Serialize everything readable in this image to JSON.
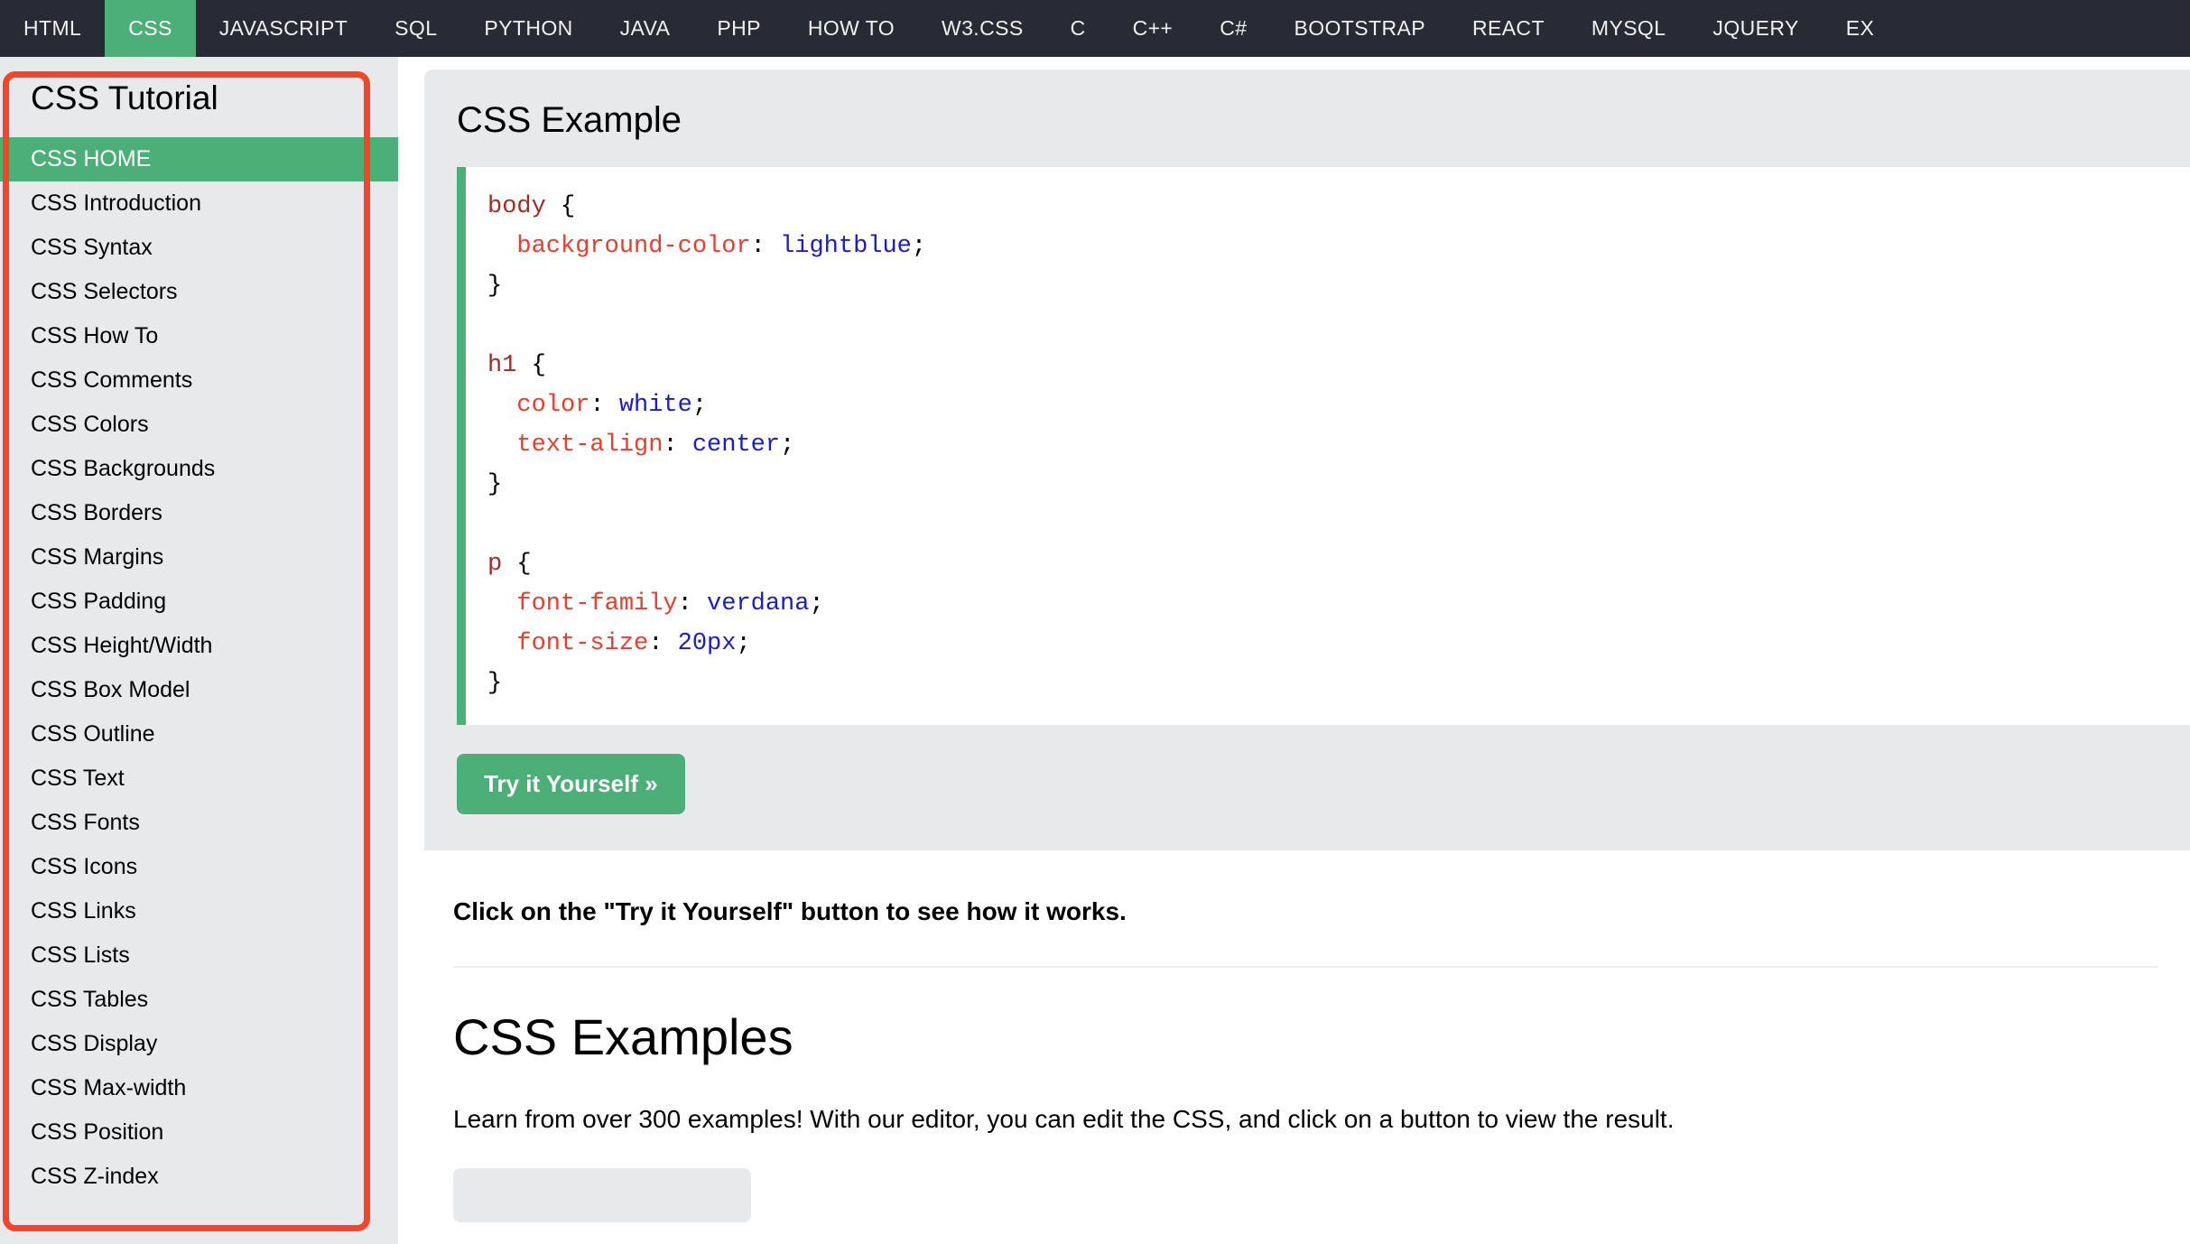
{
  "topnav": {
    "items": [
      {
        "label": "HTML",
        "active": false
      },
      {
        "label": "CSS",
        "active": true
      },
      {
        "label": "JAVASCRIPT",
        "active": false
      },
      {
        "label": "SQL",
        "active": false
      },
      {
        "label": "PYTHON",
        "active": false
      },
      {
        "label": "JAVA",
        "active": false
      },
      {
        "label": "PHP",
        "active": false
      },
      {
        "label": "HOW TO",
        "active": false
      },
      {
        "label": "W3.CSS",
        "active": false
      },
      {
        "label": "C",
        "active": false
      },
      {
        "label": "C++",
        "active": false
      },
      {
        "label": "C#",
        "active": false
      },
      {
        "label": "BOOTSTRAP",
        "active": false
      },
      {
        "label": "REACT",
        "active": false
      },
      {
        "label": "MYSQL",
        "active": false
      },
      {
        "label": "JQUERY",
        "active": false
      },
      {
        "label": "EX",
        "active": false
      }
    ]
  },
  "sidebar": {
    "title": "CSS Tutorial",
    "items": [
      {
        "label": "CSS HOME",
        "active": true
      },
      {
        "label": "CSS Introduction",
        "active": false
      },
      {
        "label": "CSS Syntax",
        "active": false
      },
      {
        "label": "CSS Selectors",
        "active": false
      },
      {
        "label": "CSS How To",
        "active": false
      },
      {
        "label": "CSS Comments",
        "active": false
      },
      {
        "label": "CSS Colors",
        "active": false
      },
      {
        "label": "CSS Backgrounds",
        "active": false
      },
      {
        "label": "CSS Borders",
        "active": false
      },
      {
        "label": "CSS Margins",
        "active": false
      },
      {
        "label": "CSS Padding",
        "active": false
      },
      {
        "label": "CSS Height/Width",
        "active": false
      },
      {
        "label": "CSS Box Model",
        "active": false
      },
      {
        "label": "CSS Outline",
        "active": false
      },
      {
        "label": "CSS Text",
        "active": false
      },
      {
        "label": "CSS Fonts",
        "active": false
      },
      {
        "label": "CSS Icons",
        "active": false
      },
      {
        "label": "CSS Links",
        "active": false
      },
      {
        "label": "CSS Lists",
        "active": false
      },
      {
        "label": "CSS Tables",
        "active": false
      },
      {
        "label": "CSS Display",
        "active": false
      },
      {
        "label": "CSS Max-width",
        "active": false
      },
      {
        "label": "CSS Position",
        "active": false
      },
      {
        "label": "CSS Z-index",
        "active": false
      }
    ]
  },
  "main": {
    "example_title": "CSS Example",
    "code_lines": [
      [
        {
          "t": "body ",
          "c": "sel"
        },
        {
          "t": "{",
          "c": "punc"
        }
      ],
      [
        {
          "t": "  ",
          "c": "punc"
        },
        {
          "t": "background-color",
          "c": "prop"
        },
        {
          "t": ": ",
          "c": "punc"
        },
        {
          "t": "lightblue",
          "c": "val"
        },
        {
          "t": ";",
          "c": "punc"
        }
      ],
      [
        {
          "t": "}",
          "c": "punc"
        }
      ],
      [
        {
          "t": "",
          "c": "punc"
        }
      ],
      [
        {
          "t": "h1 ",
          "c": "sel"
        },
        {
          "t": "{",
          "c": "punc"
        }
      ],
      [
        {
          "t": "  ",
          "c": "punc"
        },
        {
          "t": "color",
          "c": "prop"
        },
        {
          "t": ": ",
          "c": "punc"
        },
        {
          "t": "white",
          "c": "val"
        },
        {
          "t": ";",
          "c": "punc"
        }
      ],
      [
        {
          "t": "  ",
          "c": "punc"
        },
        {
          "t": "text-align",
          "c": "prop"
        },
        {
          "t": ": ",
          "c": "punc"
        },
        {
          "t": "center",
          "c": "val"
        },
        {
          "t": ";",
          "c": "punc"
        }
      ],
      [
        {
          "t": "}",
          "c": "punc"
        }
      ],
      [
        {
          "t": "",
          "c": "punc"
        }
      ],
      [
        {
          "t": "p ",
          "c": "sel"
        },
        {
          "t": "{",
          "c": "punc"
        }
      ],
      [
        {
          "t": "  ",
          "c": "punc"
        },
        {
          "t": "font-family",
          "c": "prop"
        },
        {
          "t": ": ",
          "c": "punc"
        },
        {
          "t": "verdana",
          "c": "val"
        },
        {
          "t": ";",
          "c": "punc"
        }
      ],
      [
        {
          "t": "  ",
          "c": "punc"
        },
        {
          "t": "font-size",
          "c": "prop"
        },
        {
          "t": ": ",
          "c": "punc"
        },
        {
          "t": "20px",
          "c": "val"
        },
        {
          "t": ";",
          "c": "punc"
        }
      ],
      [
        {
          "t": "}",
          "c": "punc"
        }
      ]
    ],
    "tryit_label": "Try it Yourself »",
    "note": "Click on the \"Try it Yourself\" button to see how it works.",
    "section_heading": "CSS Examples",
    "section_para": "Learn from over 300 examples! With our editor, you can edit the CSS, and click on a button to view the result."
  },
  "colors": {
    "nav_bg": "#282a35",
    "accent_green": "#4caf78",
    "sidebar_bg": "#e7e9eb",
    "annotation_red": "#f0462a",
    "code_selector": "#a52a2a",
    "code_property": "#ee3b2e",
    "code_value": "#1a1ad6"
  }
}
